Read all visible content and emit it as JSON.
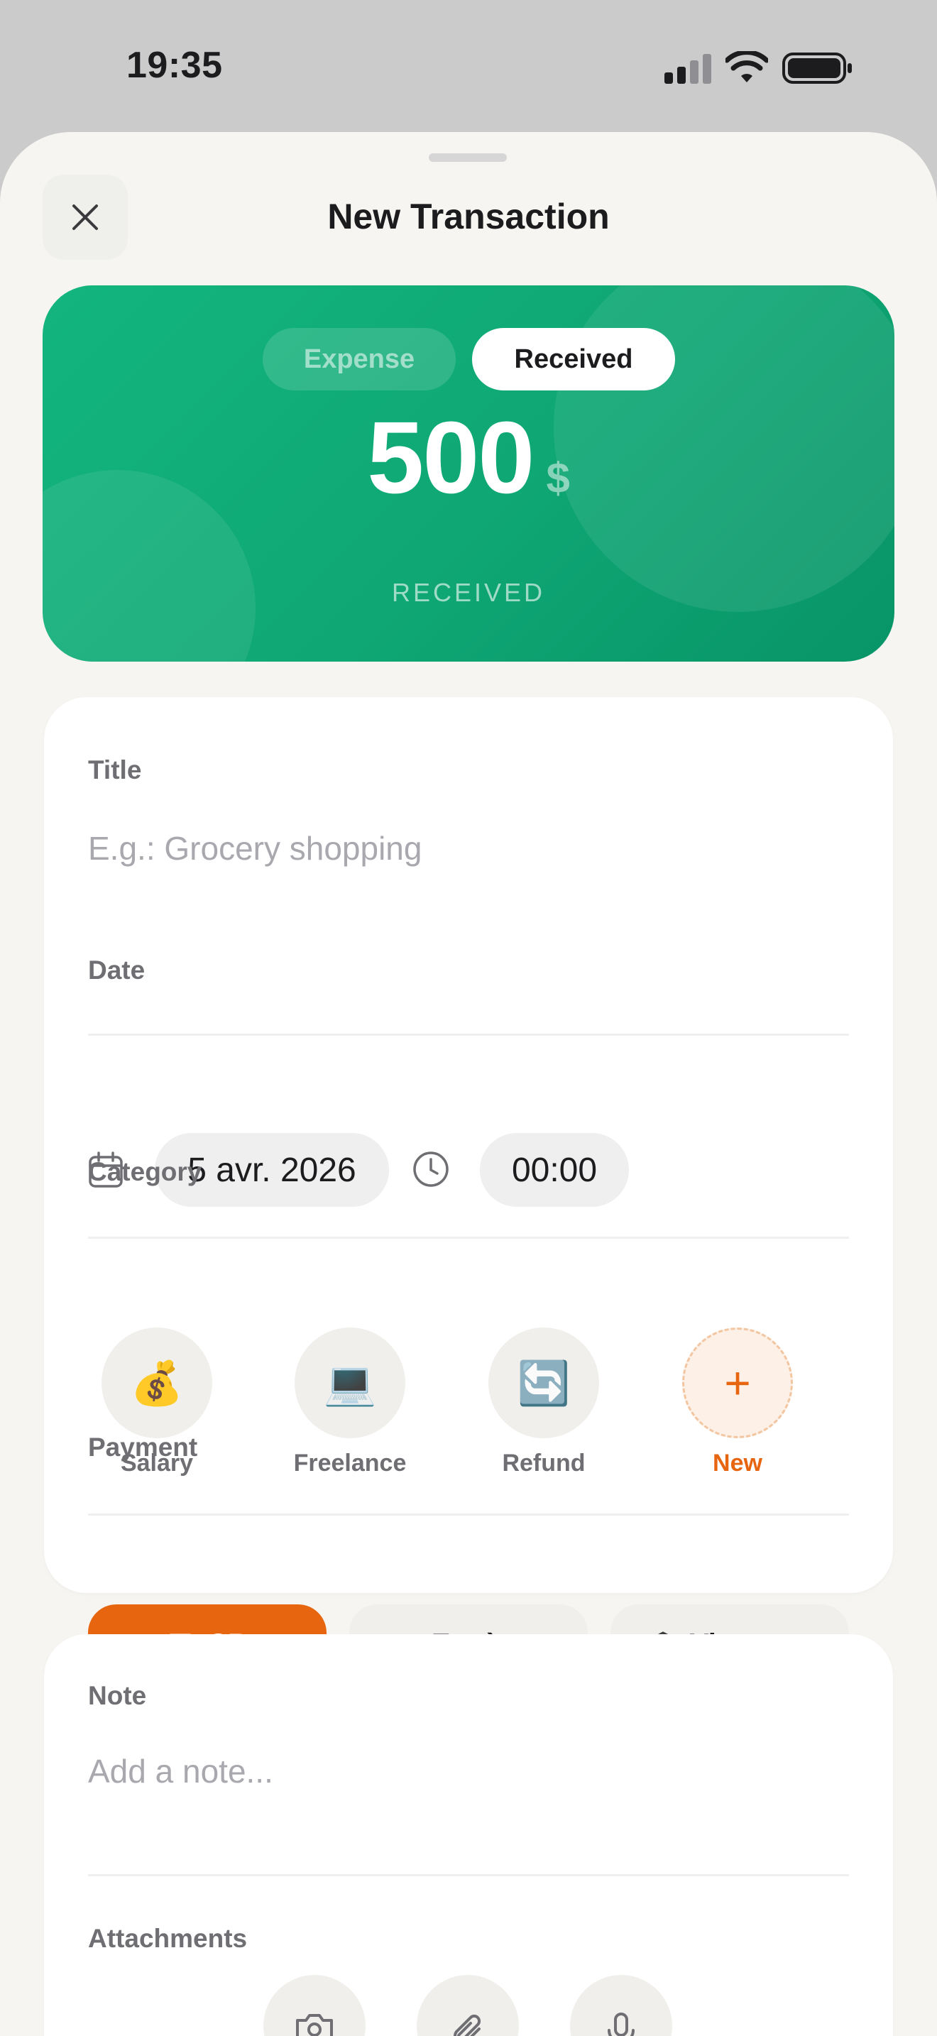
{
  "status_bar": {
    "time": "19:35"
  },
  "sheet": {
    "title": "New Transaction"
  },
  "type_toggle": {
    "expense_label": "Expense",
    "received_label": "Received",
    "selected": "Received"
  },
  "amount": {
    "value": "500",
    "currency": "$",
    "caption": "RECEIVED"
  },
  "form": {
    "title_label": "Title",
    "title_placeholder": "E.g.: Grocery shopping",
    "date_label": "Date",
    "date_value": "5 avr. 2026",
    "time_value": "00:00",
    "category_label": "Category",
    "categories": [
      {
        "label": "Salary",
        "icon": "money-bag-icon",
        "emoji": "💰"
      },
      {
        "label": "Freelance",
        "icon": "laptop-icon",
        "emoji": "💻"
      },
      {
        "label": "Refund",
        "icon": "refresh-icon",
        "emoji": "🔄"
      },
      {
        "label": "New",
        "icon": "plus-icon",
        "emoji": "+"
      }
    ],
    "payment_label": "Payment",
    "payments": [
      {
        "label": "CB",
        "icon": "credit-card-icon",
        "selected": true
      },
      {
        "label": "Espèces",
        "icon": "cash-icon",
        "selected": false
      },
      {
        "label": "Virement",
        "icon": "bank-icon",
        "selected": false
      }
    ]
  },
  "notes": {
    "note_label": "Note",
    "note_placeholder": "Add a note...",
    "attachments_label": "Attachments",
    "attachment_icons": [
      "camera-icon",
      "paperclip-icon",
      "microphone-icon"
    ]
  },
  "colors": {
    "accent_green": "#10b27b",
    "accent_orange": "#e8650f",
    "sheet_bg": "#f6f5f2"
  }
}
